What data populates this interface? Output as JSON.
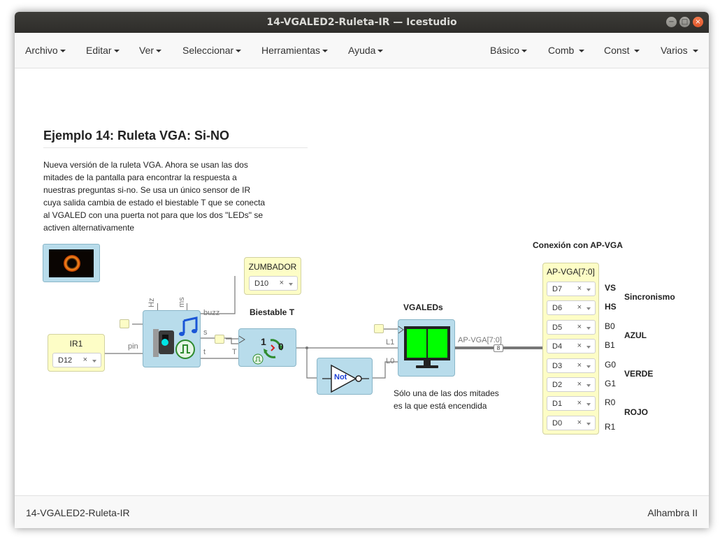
{
  "window": {
    "title": "14-VGALED2-Ruleta-IR — Icestudio",
    "buttons": {
      "minimize": "−",
      "maximize": "□",
      "close": "×"
    }
  },
  "menu": {
    "left": [
      "Archivo",
      "Editar",
      "Ver",
      "Seleccionar",
      "Herramientas",
      "Ayuda"
    ],
    "right": [
      "Básico",
      "Comb",
      "Const",
      "Varios"
    ]
  },
  "canvas": {
    "heading": "Ejemplo 14: Ruleta VGA: Si-NO",
    "description": "Nueva versión de la ruleta VGA. Ahora se usan las dos mitades de la pantalla para encontrar la respuesta a nuestras preguntas si-no. Se usa un único sensor de IR cuya salida cambia de estado el biestable T que se conecta al VGALED con una puerta not para que los dos \"LEDs\" se activen alternativamente",
    "ir1": {
      "title": "IR1",
      "pin": "D12"
    },
    "zumbador": {
      "title": "ZUMBADOR",
      "pin": "D10"
    },
    "buzzer_block": {
      "ports": {
        "hz": "Hz",
        "ms": "ms",
        "pin": "pin",
        "buzz": "buzz",
        "s": "s",
        "t": "t"
      }
    },
    "biestable": {
      "label": "Biestable T",
      "port_t": "T",
      "one": "1",
      "zero": "0"
    },
    "not_gate": {
      "label": "Not"
    },
    "vgaleds": {
      "label": "VGALEDs",
      "port_l1": "L1",
      "port_l0": "L0"
    },
    "bus_label": "AP-VGA[7:0]",
    "bus_width": "8",
    "note": "Sólo una de las dos mitades es la que está encendida",
    "conexion": {
      "label": "Conexión con AP-VGA",
      "block_title": "AP-VGA[7:0]",
      "pins": [
        {
          "pin": "D7",
          "signal": "VS",
          "bold": true
        },
        {
          "pin": "D6",
          "signal": "HS",
          "bold": true
        },
        {
          "pin": "D5",
          "signal": "B0",
          "bold": false
        },
        {
          "pin": "D4",
          "signal": "B1",
          "bold": false
        },
        {
          "pin": "D3",
          "signal": "G0",
          "bold": false
        },
        {
          "pin": "D2",
          "signal": "G1",
          "bold": false
        },
        {
          "pin": "D1",
          "signal": "R0",
          "bold": false
        },
        {
          "pin": "D0",
          "signal": "R1",
          "bold": false
        }
      ],
      "groups": [
        "Sincronismo",
        "AZUL",
        "VERDE",
        "ROJO"
      ]
    },
    "clear_symbol": "×"
  },
  "status": {
    "left": "14-VGALED2-Ruleta-IR",
    "right": "Alhambra II"
  },
  "colors": {
    "titlebar": "#2e2d2a",
    "module": "#b8dceb",
    "io_block": "#fdfdc6",
    "led_green": "#00ff00"
  }
}
